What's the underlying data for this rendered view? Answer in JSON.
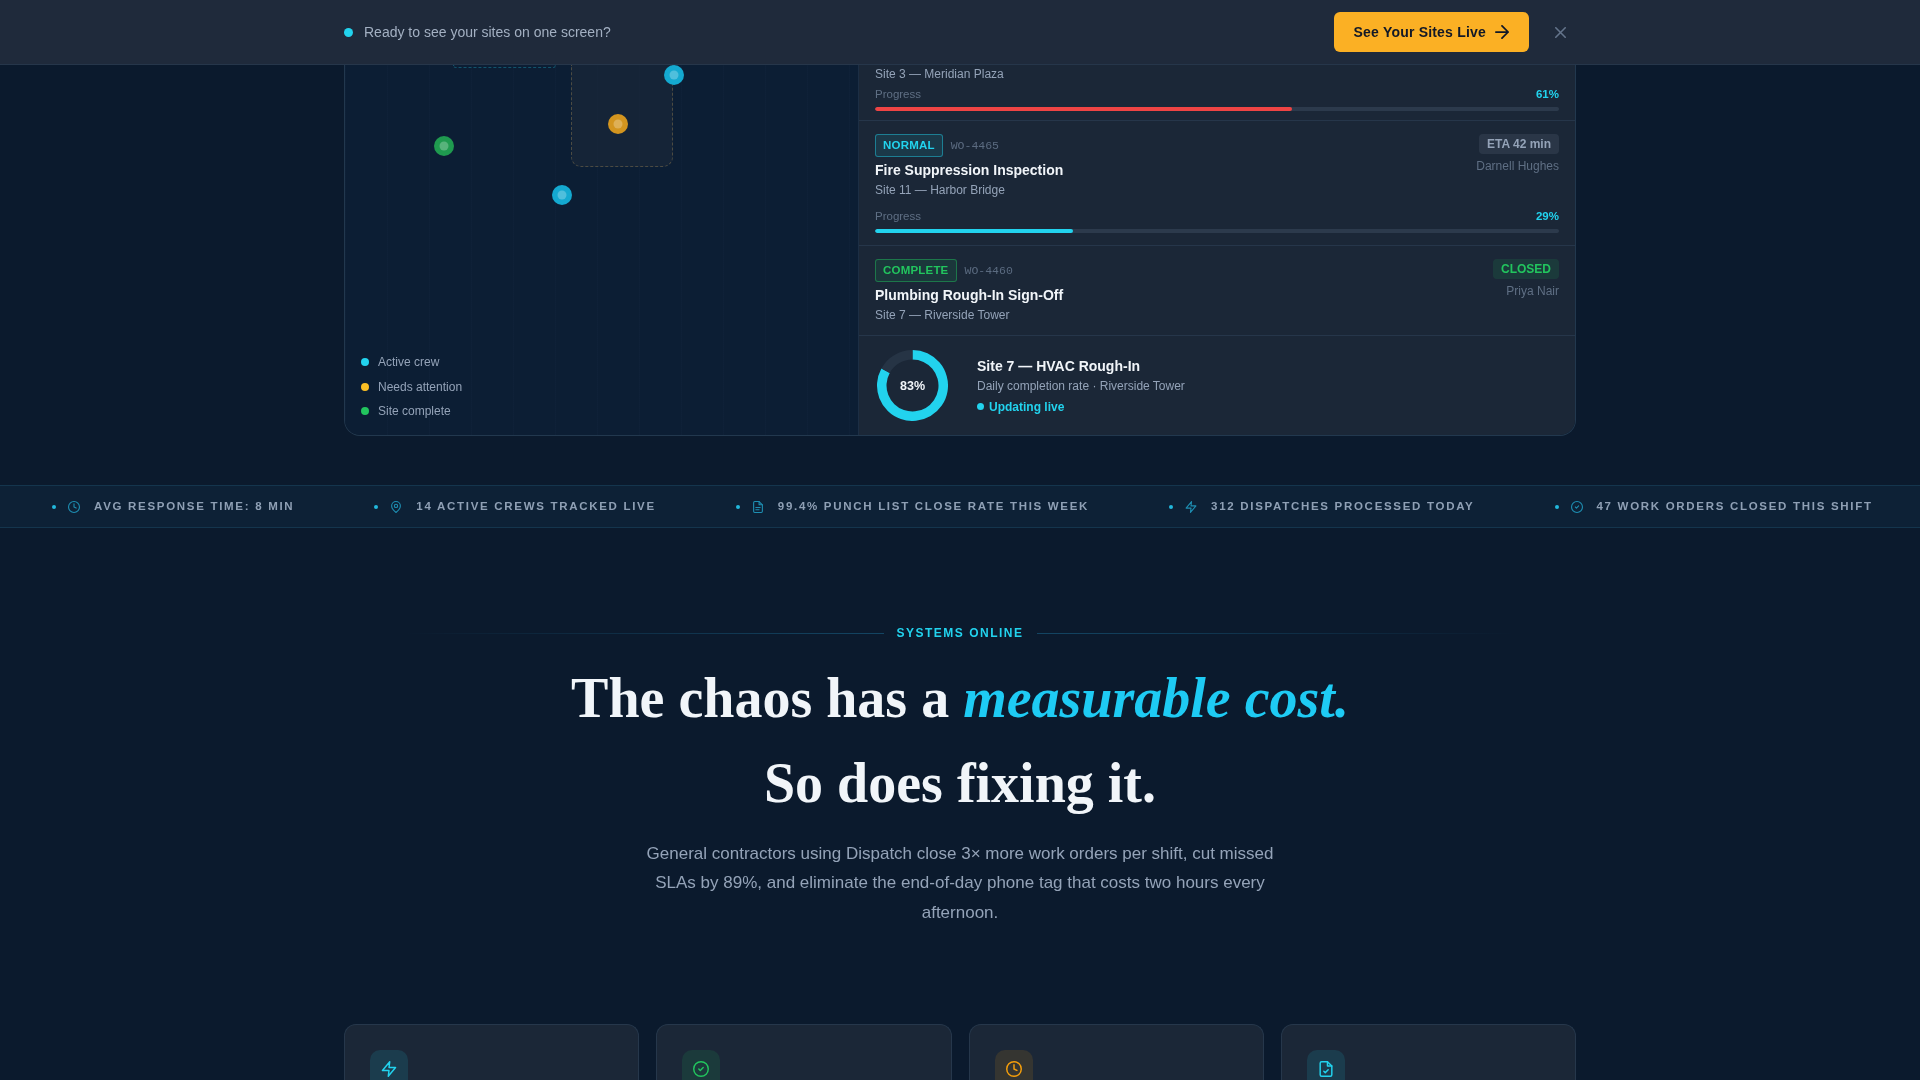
{
  "banner": {
    "message": "Ready to see your sites on one screen?",
    "button": "See Your Sites Live"
  },
  "map": {
    "markers": [
      {
        "color": "#14a9d0"
      },
      {
        "color": "#d3951f"
      },
      {
        "color": "#1f9a4f"
      },
      {
        "color": "#14a9d0"
      }
    ],
    "legend": [
      {
        "label": "Active crew",
        "color": "#22d3ee"
      },
      {
        "label": "Needs attention",
        "color": "#fbbf24"
      },
      {
        "label": "Site complete",
        "color": "#22c55e"
      }
    ]
  },
  "work_orders": [
    {
      "site": "Site 3 — Meridian Plaza",
      "progress": {
        "label": "Progress",
        "level": 0.61,
        "reading": "61%",
        "color": "#ef4444"
      }
    },
    {
      "badge": {
        "text": "NORMAL",
        "color": "#22d3ee"
      },
      "id": "WO-4465",
      "title": "Fire Suppression Inspection",
      "site": "Site 11 — Harbor Bridge",
      "status": {
        "text": "ETA 42 min",
        "color": "#94a3b8"
      },
      "assignee": "Darnell Hughes",
      "progress": {
        "label": "Progress",
        "level": 0.29,
        "reading": "29%",
        "color": "#22d3ee"
      }
    },
    {
      "badge": {
        "text": "COMPLETE",
        "color": "#22c55e"
      },
      "id": "WO-4460",
      "title": "Plumbing Rough-In Sign-Off",
      "site": "Site 7 — Riverside Tower",
      "status": {
        "text": "CLOSED",
        "color": "#22c55e"
      },
      "assignee": "Priya Nair"
    }
  ],
  "summary": {
    "chart_data": {
      "type": "donut",
      "values": [
        83,
        17
      ],
      "colors": [
        "#22d3ee",
        "#263445"
      ]
    },
    "reading": "83%",
    "title": "Site 7 — HVAC Rough-In",
    "subtitle": "Daily completion rate · Riverside Tower",
    "live": "Updating live"
  },
  "ticker": [
    {
      "text": "AVG RESPONSE TIME: 8 MIN"
    },
    {
      "text": "14 ACTIVE CREWS TRACKED LIVE"
    },
    {
      "text": "99.4% PUNCH LIST CLOSE RATE THIS WEEK"
    },
    {
      "text": "312 DISPATCHES PROCESSED TODAY"
    },
    {
      "text": "47 WORK ORDERS CLOSED THIS SHIFT"
    }
  ],
  "section": {
    "eyebrow": "SYSTEMS ONLINE",
    "heading": [
      "The chaos has a *measurable cost.*",
      "So does fixing it."
    ],
    "body": "General contractors using Dispatch close 3× more work orders per shift, cut missed SLAs by 89%, and eliminate the end-of-day phone tag that costs two hours every afternoon."
  },
  "feature_cards": [
    {
      "color": "#22d3ee"
    },
    {
      "color": "#22c55e"
    },
    {
      "color": "#f59e0b"
    },
    {
      "color": "#22d3ee"
    }
  ]
}
